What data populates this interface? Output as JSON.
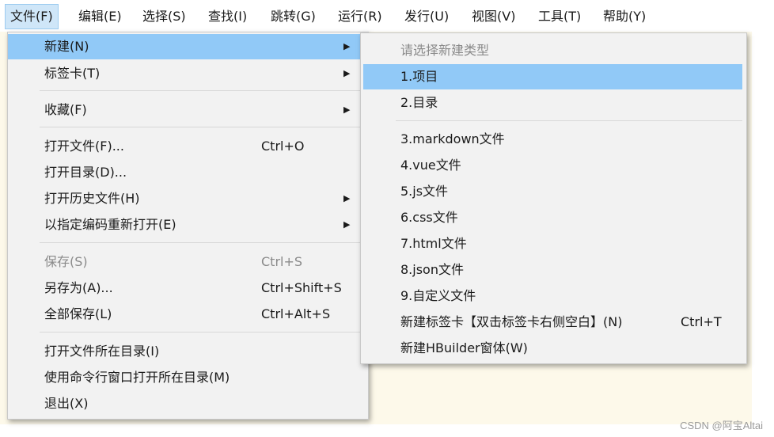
{
  "menubar": {
    "items": [
      {
        "label": "文件(F)"
      },
      {
        "label": "编辑(E)"
      },
      {
        "label": "选择(S)"
      },
      {
        "label": "查找(I)"
      },
      {
        "label": "跳转(G)"
      },
      {
        "label": "运行(R)"
      },
      {
        "label": "发行(U)"
      },
      {
        "label": "视图(V)"
      },
      {
        "label": "工具(T)"
      },
      {
        "label": "帮助(Y)"
      }
    ]
  },
  "file_menu": {
    "items": [
      {
        "label": "新建(N)",
        "arrow": "▶"
      },
      {
        "label": "标签卡(T)",
        "arrow": "▶"
      },
      {
        "label": "收藏(F)",
        "arrow": "▶"
      },
      {
        "label": "打开文件(F)...",
        "shortcut": "Ctrl+O"
      },
      {
        "label": "打开目录(D)..."
      },
      {
        "label": "打开历史文件(H)",
        "arrow": "▶"
      },
      {
        "label": "以指定编码重新打开(E)",
        "arrow": "▶"
      },
      {
        "label": "保存(S)",
        "shortcut": "Ctrl+S"
      },
      {
        "label": "另存为(A)...",
        "shortcut": "Ctrl+Shift+S"
      },
      {
        "label": "全部保存(L)",
        "shortcut": "Ctrl+Alt+S"
      },
      {
        "label": "打开文件所在目录(I)"
      },
      {
        "label": "使用命令行窗口打开所在目录(M)"
      },
      {
        "label": "退出(X)"
      }
    ]
  },
  "new_submenu": {
    "items": [
      {
        "label": "请选择新建类型"
      },
      {
        "label": "1.项目"
      },
      {
        "label": "2.目录"
      },
      {
        "label": "3.markdown文件"
      },
      {
        "label": "4.vue文件"
      },
      {
        "label": "5.js文件"
      },
      {
        "label": "6.css文件"
      },
      {
        "label": "7.html文件"
      },
      {
        "label": "8.json文件"
      },
      {
        "label": "9.自定义文件"
      },
      {
        "label": "新建标签卡【双击标签卡右侧空白】(N)",
        "shortcut": "Ctrl+T"
      },
      {
        "label": "新建HBuilder窗体(W)"
      }
    ]
  },
  "watermark": "CSDN @阿宝Altai"
}
